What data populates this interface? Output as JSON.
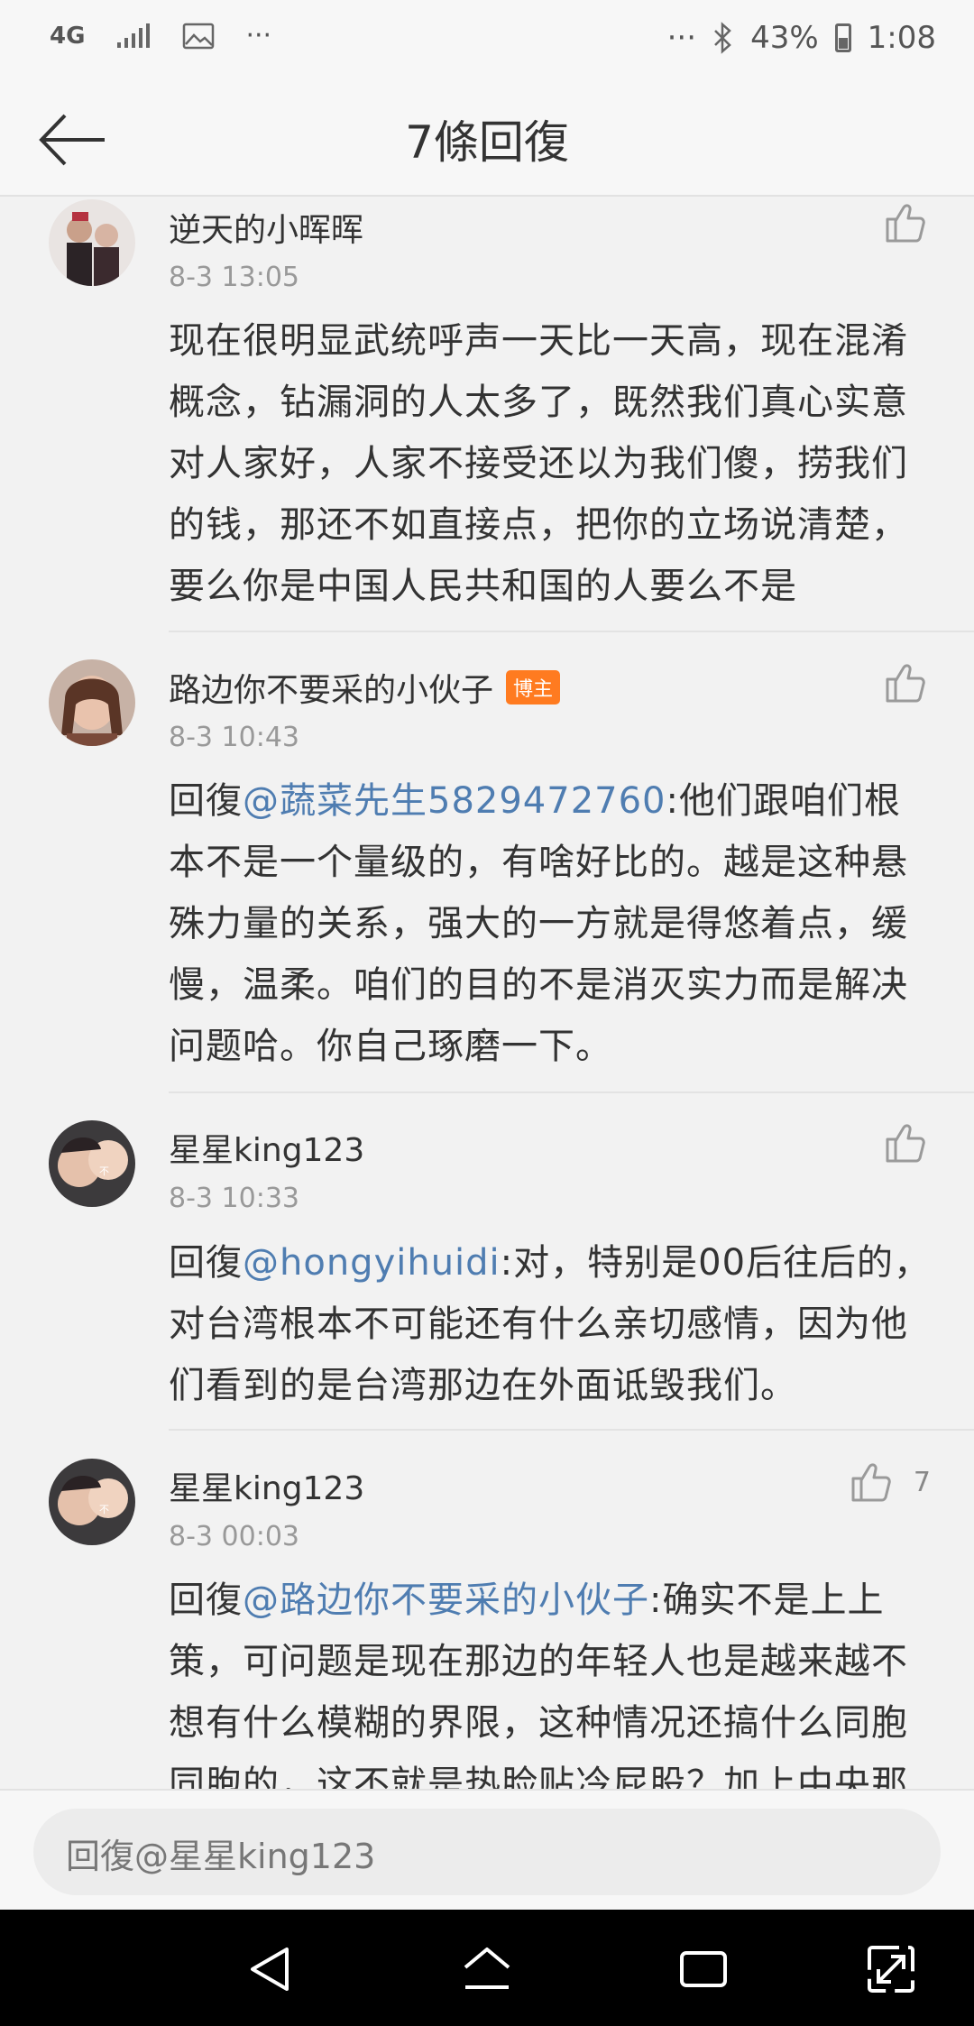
{
  "status_bar": {
    "network": "4G",
    "signal": "signal-icon",
    "gallery": "image-icon",
    "more_left": "···",
    "more_right": "···",
    "bluetooth": "bluetooth-icon",
    "battery_percent": "43%",
    "time": "1:08"
  },
  "header": {
    "title": "7條回復"
  },
  "comments": [
    {
      "name": "逆天的小晖晖",
      "time": "8-3 13:05",
      "text": "现在很明显武统呼声一天比一天高，现在混淆概念，钻漏洞的人太多了，既然我们真心实意对人家好，人家不接受还以为我们傻，捞我们的钱，那还不如直接点，把你的立场说清楚，要么你是中国人民共和国的人要么不是"
    },
    {
      "name": "路边你不要采的小伙子",
      "badge": "博主",
      "time": "8-3 10:43",
      "prefix": "回復",
      "mention": "@蔬菜先生5829472760",
      "text": ":他们跟咱们根本不是一个量级的，有啥好比的。越是这种悬殊力量的关系，强大的一方就是得悠着点，缓慢，温柔。咱们的目的不是消灭实力而是解决问题哈。你自己琢磨一下。"
    },
    {
      "name": "星星king123",
      "time": "8-3 10:33",
      "prefix": "回復",
      "mention": "@hongyihuidi",
      "text": ":对，特别是00后往后的，对台湾根本不可能还有什么亲切感情，因为他们看到的是台湾那边在外面诋毁我们。"
    },
    {
      "name": "星星king123",
      "time": "8-3 00:03",
      "like_count": "7",
      "prefix": "回復",
      "mention": "@路边你不要采的小伙子",
      "text": ":确实不是上上策，可问题是现在那边的年轻人也是越来越不想有什么模糊的界限，这种情况还搞什么同胞同胞的，这不就是热脸贴冷屁股？加上中央那"
    }
  ],
  "input": {
    "placeholder": "回復@星星king123"
  },
  "nav": {
    "back": "back-icon",
    "home": "home-icon",
    "recents": "recents-icon",
    "expand": "expand-icon"
  }
}
